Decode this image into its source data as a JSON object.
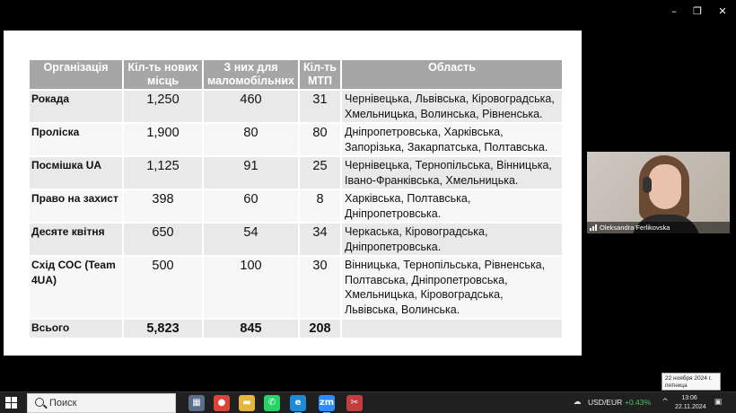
{
  "window": {
    "minimize_icon": "minimize-icon",
    "restore_icon": "restore-icon",
    "close_icon": "close-icon",
    "minimize_glyph": "–",
    "restore_glyph": "❐",
    "close_glyph": "✕"
  },
  "table": {
    "headers": [
      "Організація",
      "Кіл-ть нових місць",
      "З них для маломобільних",
      "Кіл-ть МТП",
      "Область"
    ],
    "rows": [
      {
        "org": "Рокада",
        "places": "1,250",
        "mobility": "460",
        "mtp": "31",
        "region": "Чернівецька, Львівська, Кіровоградська, Хмельницька, Волинська, Рівненська."
      },
      {
        "org": "Проліска",
        "places": "1,900",
        "mobility": "80",
        "mtp": "80",
        "region": "Дніпропетровська, Харківська, Запорізька, Закарпатська, Полтавська."
      },
      {
        "org": "Посмішка UA",
        "places": "1,125",
        "mobility": "91",
        "mtp": "25",
        "region": "Чернівецька, Тернопільська, Вінницька, Івано-Франківська, Хмельницька."
      },
      {
        "org": "Право на захист",
        "places": "398",
        "mobility": "60",
        "mtp": "8",
        "region": "Харківська, Полтавська, Дніпропетровська."
      },
      {
        "org": "Десяте квітня",
        "places": "650",
        "mobility": "54",
        "mtp": "34",
        "region": "Черкаська, Кіровоградська, Дніпропетровська."
      },
      {
        "org": "Схід СОС (Team 4UA)",
        "places": "500",
        "mobility": "100",
        "mtp": "30",
        "region": "Вінницька, Тернопільська, Рівненська, Полтавська, Дніпропетровська, Хмельницька, Кіровоградська, Львівська, Волинська."
      }
    ],
    "total": {
      "label": "Всього",
      "places": "5,823",
      "mobility": "845",
      "mtp": "208",
      "region": ""
    }
  },
  "video": {
    "participant_name": "Oleksandra Ferlikovska",
    "signal_icon": "signal-bars-icon"
  },
  "tooltip": {
    "date_line": "22 ноября 2024 г.",
    "weekday": "пятница"
  },
  "taskbar": {
    "search_placeholder": "Поиск",
    "apps": [
      {
        "name": "calculator-app",
        "glyph": "▦",
        "color": "#5b6f8a"
      },
      {
        "name": "chrome-app",
        "glyph": "●",
        "color": "#db4437"
      },
      {
        "name": "file-explorer-app",
        "glyph": "▬",
        "color": "#e8b53c"
      },
      {
        "name": "whatsapp-app",
        "glyph": "✆",
        "color": "#25d366"
      },
      {
        "name": "edge-app",
        "glyph": "e",
        "color": "#1f8ad6"
      },
      {
        "name": "zoom-app",
        "glyph": "zm",
        "color": "#2d8cff"
      },
      {
        "name": "snipping-tool-app",
        "glyph": "✂",
        "color": "#c43e3e"
      }
    ],
    "currency_pair": "USD/EUR",
    "currency_change": "+0.43%",
    "currency_color": "#4cc26a",
    "time": "13:06",
    "date": "22.11.2024"
  }
}
